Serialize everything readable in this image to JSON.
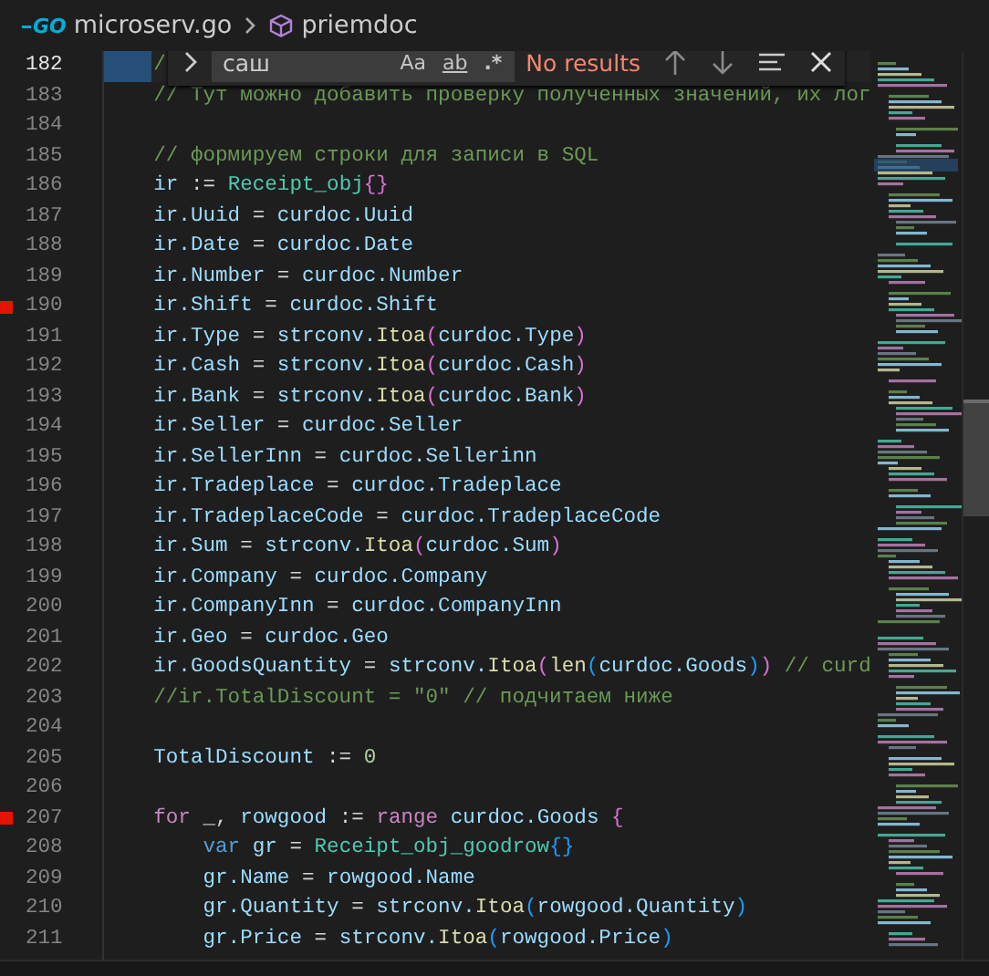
{
  "breadcrumbs": [
    {
      "kind": "file",
      "icon_text": "GO",
      "text": "microserv.go"
    },
    {
      "kind": "symbol",
      "text": "priemdoc"
    }
  ],
  "find_widget": {
    "query": "саш",
    "status": "No results",
    "options": [
      {
        "label": "Aa",
        "kind": "case",
        "on": false
      },
      {
        "label": "ab",
        "kind": "word",
        "on": false
      },
      {
        "label": ".*",
        "kind": "regex",
        "on": false
      }
    ]
  },
  "lines": [
    {
      "n": "182",
      "current": true,
      "breakpoint": false,
      "tokens": [
        {
          "kind": "c",
          "text": "    /"
        }
      ]
    },
    {
      "n": "183",
      "current": false,
      "breakpoint": false,
      "tokens": [
        {
          "kind": "c",
          "text": "    // Тут можно добавить проверку полученных значений, их лог"
        }
      ]
    },
    {
      "n": "184",
      "current": false,
      "breakpoint": false
    },
    {
      "n": "185",
      "current": false,
      "breakpoint": false,
      "tokens": [
        {
          "kind": "c",
          "text": "    // формируем строки для записи в SQL"
        }
      ]
    },
    {
      "n": "186",
      "current": false,
      "breakpoint": false,
      "tokens": [
        {
          "kind": "v",
          "text": "    ir"
        },
        {
          "kind": "p",
          "text": " := "
        },
        {
          "kind": "t",
          "text": "Receipt_obj"
        },
        {
          "kind": "b2",
          "text": "{}"
        }
      ]
    },
    {
      "n": "187",
      "current": false,
      "breakpoint": false,
      "tokens": [
        {
          "kind": "v",
          "text": "    ir.Uuid"
        },
        {
          "kind": "p",
          "text": " = "
        },
        {
          "kind": "v",
          "text": "curdoc.Uuid"
        }
      ]
    },
    {
      "n": "188",
      "current": false,
      "breakpoint": false,
      "tokens": [
        {
          "kind": "v",
          "text": "    ir.Date"
        },
        {
          "kind": "p",
          "text": " = "
        },
        {
          "kind": "v",
          "text": "curdoc.Date"
        }
      ]
    },
    {
      "n": "189",
      "current": false,
      "breakpoint": false,
      "tokens": [
        {
          "kind": "v",
          "text": "    ir.Number"
        },
        {
          "kind": "p",
          "text": " = "
        },
        {
          "kind": "v",
          "text": "curdoc.Number"
        }
      ]
    },
    {
      "n": "190",
      "current": false,
      "breakpoint": true,
      "tokens": [
        {
          "kind": "v",
          "text": "    ir.Shift"
        },
        {
          "kind": "p",
          "text": " = "
        },
        {
          "kind": "v",
          "text": "curdoc.Shift"
        }
      ]
    },
    {
      "n": "191",
      "current": false,
      "breakpoint": false,
      "tokens": [
        {
          "kind": "v",
          "text": "    ir.Type"
        },
        {
          "kind": "p",
          "text": " = "
        },
        {
          "kind": "v",
          "text": "strconv."
        },
        {
          "kind": "f",
          "text": "Itoa"
        },
        {
          "kind": "b2",
          "text": "("
        },
        {
          "kind": "v",
          "text": "curdoc.Type"
        },
        {
          "kind": "b2",
          "text": ")"
        }
      ]
    },
    {
      "n": "192",
      "current": false,
      "breakpoint": false,
      "tokens": [
        {
          "kind": "v",
          "text": "    ir.Cash"
        },
        {
          "kind": "p",
          "text": " = "
        },
        {
          "kind": "v",
          "text": "strconv."
        },
        {
          "kind": "f",
          "text": "Itoa"
        },
        {
          "kind": "b2",
          "text": "("
        },
        {
          "kind": "v",
          "text": "curdoc.Cash"
        },
        {
          "kind": "b2",
          "text": ")"
        }
      ]
    },
    {
      "n": "193",
      "current": false,
      "breakpoint": false,
      "tokens": [
        {
          "kind": "v",
          "text": "    ir.Bank"
        },
        {
          "kind": "p",
          "text": " = "
        },
        {
          "kind": "v",
          "text": "strconv."
        },
        {
          "kind": "f",
          "text": "Itoa"
        },
        {
          "kind": "b2",
          "text": "("
        },
        {
          "kind": "v",
          "text": "curdoc.Bank"
        },
        {
          "kind": "b2",
          "text": ")"
        }
      ]
    },
    {
      "n": "194",
      "current": false,
      "breakpoint": false,
      "tokens": [
        {
          "kind": "v",
          "text": "    ir.Seller"
        },
        {
          "kind": "p",
          "text": " = "
        },
        {
          "kind": "v",
          "text": "curdoc.Seller"
        }
      ]
    },
    {
      "n": "195",
      "current": false,
      "breakpoint": false,
      "tokens": [
        {
          "kind": "v",
          "text": "    ir.SellerInn"
        },
        {
          "kind": "p",
          "text": " = "
        },
        {
          "kind": "v",
          "text": "curdoc.Sellerinn"
        }
      ]
    },
    {
      "n": "196",
      "current": false,
      "breakpoint": false,
      "tokens": [
        {
          "kind": "v",
          "text": "    ir.Tradeplace"
        },
        {
          "kind": "p",
          "text": " = "
        },
        {
          "kind": "v",
          "text": "curdoc.Tradeplace"
        }
      ]
    },
    {
      "n": "197",
      "current": false,
      "breakpoint": false,
      "tokens": [
        {
          "kind": "v",
          "text": "    ir.TradeplaceCode"
        },
        {
          "kind": "p",
          "text": " = "
        },
        {
          "kind": "v",
          "text": "curdoc.TradeplaceCode"
        }
      ]
    },
    {
      "n": "198",
      "current": false,
      "breakpoint": false,
      "tokens": [
        {
          "kind": "v",
          "text": "    ir.Sum"
        },
        {
          "kind": "p",
          "text": " = "
        },
        {
          "kind": "v",
          "text": "strconv."
        },
        {
          "kind": "f",
          "text": "Itoa"
        },
        {
          "kind": "b2",
          "text": "("
        },
        {
          "kind": "v",
          "text": "curdoc.Sum"
        },
        {
          "kind": "b2",
          "text": ")"
        }
      ]
    },
    {
      "n": "199",
      "current": false,
      "breakpoint": false,
      "tokens": [
        {
          "kind": "v",
          "text": "    ir.Company"
        },
        {
          "kind": "p",
          "text": " = "
        },
        {
          "kind": "v",
          "text": "curdoc.Company"
        }
      ]
    },
    {
      "n": "200",
      "current": false,
      "breakpoint": false,
      "tokens": [
        {
          "kind": "v",
          "text": "    ir.CompanyInn"
        },
        {
          "kind": "p",
          "text": " = "
        },
        {
          "kind": "v",
          "text": "curdoc.CompanyInn"
        }
      ]
    },
    {
      "n": "201",
      "current": false,
      "breakpoint": false,
      "tokens": [
        {
          "kind": "v",
          "text": "    ir.Geo"
        },
        {
          "kind": "p",
          "text": " = "
        },
        {
          "kind": "v",
          "text": "curdoc.Geo"
        }
      ]
    },
    {
      "n": "202",
      "current": false,
      "breakpoint": false,
      "tokens": [
        {
          "kind": "v",
          "text": "    ir.GoodsQuantity"
        },
        {
          "kind": "p",
          "text": " = "
        },
        {
          "kind": "v",
          "text": "strconv."
        },
        {
          "kind": "f",
          "text": "Itoa"
        },
        {
          "kind": "b2",
          "text": "("
        },
        {
          "kind": "f",
          "text": "len"
        },
        {
          "kind": "b3",
          "text": "("
        },
        {
          "kind": "v",
          "text": "curdoc.Goods"
        },
        {
          "kind": "b3",
          "text": ")"
        },
        {
          "kind": "b2",
          "text": ")"
        },
        {
          "kind": "c",
          "text": " // curd"
        }
      ]
    },
    {
      "n": "203",
      "current": false,
      "breakpoint": false,
      "tokens": [
        {
          "kind": "c",
          "text": "    //ir.TotalDiscount = \"0\" // подчитаем ниже"
        }
      ]
    },
    {
      "n": "204",
      "current": false,
      "breakpoint": false
    },
    {
      "n": "205",
      "current": false,
      "breakpoint": false,
      "tokens": [
        {
          "kind": "v",
          "text": "    TotalDiscount"
        },
        {
          "kind": "p",
          "text": " := "
        },
        {
          "kind": "n",
          "text": "0"
        }
      ]
    },
    {
      "n": "206",
      "current": false,
      "breakpoint": false
    },
    {
      "n": "207",
      "current": false,
      "breakpoint": true,
      "tokens": [
        {
          "kind": "k",
          "text": "    for"
        },
        {
          "kind": "p",
          "text": " _, "
        },
        {
          "kind": "v",
          "text": "rowgood"
        },
        {
          "kind": "p",
          "text": " := "
        },
        {
          "kind": "k",
          "text": "range"
        },
        {
          "kind": "v",
          "text": " curdoc.Goods"
        },
        {
          "kind": "b2",
          "text": " {"
        }
      ]
    },
    {
      "n": "208",
      "current": false,
      "breakpoint": false,
      "tokens": [
        {
          "kind": "kw",
          "text": "        var"
        },
        {
          "kind": "v",
          "text": " gr"
        },
        {
          "kind": "p",
          "text": " = "
        },
        {
          "kind": "t",
          "text": "Receipt_obj_goodrow"
        },
        {
          "kind": "b3",
          "text": "{}"
        }
      ]
    },
    {
      "n": "209",
      "current": false,
      "breakpoint": false,
      "tokens": [
        {
          "kind": "v",
          "text": "        gr.Name"
        },
        {
          "kind": "p",
          "text": " = "
        },
        {
          "kind": "v",
          "text": "rowgood.Name"
        }
      ]
    },
    {
      "n": "210",
      "current": false,
      "breakpoint": false,
      "tokens": [
        {
          "kind": "v",
          "text": "        gr.Quantity"
        },
        {
          "kind": "p",
          "text": " = "
        },
        {
          "kind": "v",
          "text": "strconv."
        },
        {
          "kind": "f",
          "text": "Itoa"
        },
        {
          "kind": "b3",
          "text": "("
        },
        {
          "kind": "v",
          "text": "rowgood.Quantity"
        },
        {
          "kind": "b3",
          "text": ")"
        }
      ]
    },
    {
      "n": "211",
      "current": false,
      "breakpoint": false,
      "tokens": [
        {
          "kind": "v",
          "text": "        gr.Price"
        },
        {
          "kind": "p",
          "text": " = "
        },
        {
          "kind": "v",
          "text": "strconv."
        },
        {
          "kind": "f",
          "text": "Itoa"
        },
        {
          "kind": "b3",
          "text": "("
        },
        {
          "kind": "v",
          "text": "rowgood.Price"
        },
        {
          "kind": "b3",
          "text": ")"
        }
      ]
    }
  ]
}
